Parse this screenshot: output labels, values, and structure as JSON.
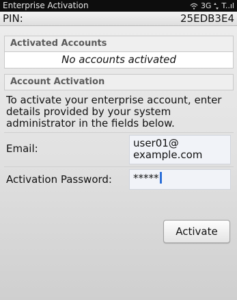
{
  "status_bar": {
    "app_title": "Enterprise Activation",
    "network": "3G",
    "signal_text": "T..ıl",
    "wifi_icon": "wifi-icon",
    "signal_icon": "signal-bars-icon"
  },
  "pin": {
    "label": "PIN:",
    "value": "25EDB3E4"
  },
  "activated_accounts": {
    "header": "Activated Accounts",
    "empty_message": "No accounts activated"
  },
  "account_activation": {
    "header": "Account Activation",
    "description": "To activate your enterprise account, enter details provided by your system administrator in the fields below.",
    "email_label": "Email:",
    "email_value": "user01@\nexample.com",
    "password_label": "Activation Password:",
    "password_value": "*****",
    "activate_label": "Activate"
  },
  "colors": {
    "status_bar_bg": "#0d0d0d",
    "cursor": "#2c6fd8",
    "input_bg": "#f1f3f8"
  }
}
